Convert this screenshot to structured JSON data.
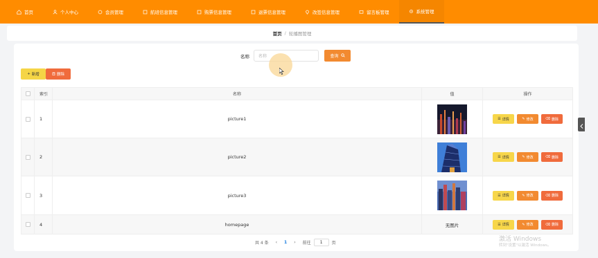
{
  "nav": {
    "items": [
      {
        "label": "首页",
        "icon": "home-icon",
        "active": false
      },
      {
        "label": "个人中心",
        "icon": "user-icon",
        "active": false
      },
      {
        "label": "会员管理",
        "icon": "people-icon",
        "active": false
      },
      {
        "label": "航班信息管理",
        "icon": "plane-icon",
        "active": false
      },
      {
        "label": "购票信息管理",
        "icon": "ticket-icon",
        "active": false
      },
      {
        "label": "退票信息管理",
        "icon": "return-icon",
        "active": false
      },
      {
        "label": "改签信息管理",
        "icon": "location-icon",
        "active": false
      },
      {
        "label": "留言板管理",
        "icon": "message-icon",
        "active": false
      },
      {
        "label": "系统管理",
        "icon": "gear-icon",
        "active": true
      }
    ]
  },
  "breadcrumb": {
    "home": "首页",
    "separator": "/",
    "current": "轮播图管理"
  },
  "search": {
    "label": "名称",
    "placeholder": "名称",
    "button": "查询"
  },
  "toolbar": {
    "add_label": "新增",
    "delete_label": "删除"
  },
  "table": {
    "headers": {
      "index": "索引",
      "name": "名称",
      "value": "值",
      "ops": "操作"
    },
    "rows": [
      {
        "index": "1",
        "name": "picture1",
        "image": "thumb-city-night",
        "value_text": ""
      },
      {
        "index": "2",
        "name": "picture2",
        "image": "thumb-building-blue",
        "value_text": ""
      },
      {
        "index": "3",
        "name": "picture3",
        "image": "thumb-skyline",
        "value_text": ""
      },
      {
        "index": "4",
        "name": "homepage",
        "image": "",
        "value_text": "无图片"
      }
    ],
    "actions": {
      "detail": "详情",
      "edit": "修改",
      "delete": "删除"
    }
  },
  "pagination": {
    "total": "共 4 条",
    "prev": "‹",
    "current_page": "1",
    "next": "›",
    "goto_label": "前往",
    "goto_value": "1",
    "page_unit": "页"
  },
  "watermark": {
    "line1": "激活 Windows",
    "line2": "转到\"设置\"以激活 Windows。"
  },
  "colors": {
    "nav_bg": "#ff8c00",
    "accent_orange": "#f28a30",
    "yellow": "#f7d64a",
    "red_orange": "#f06b3c",
    "pager_active": "#1a7ee0"
  }
}
